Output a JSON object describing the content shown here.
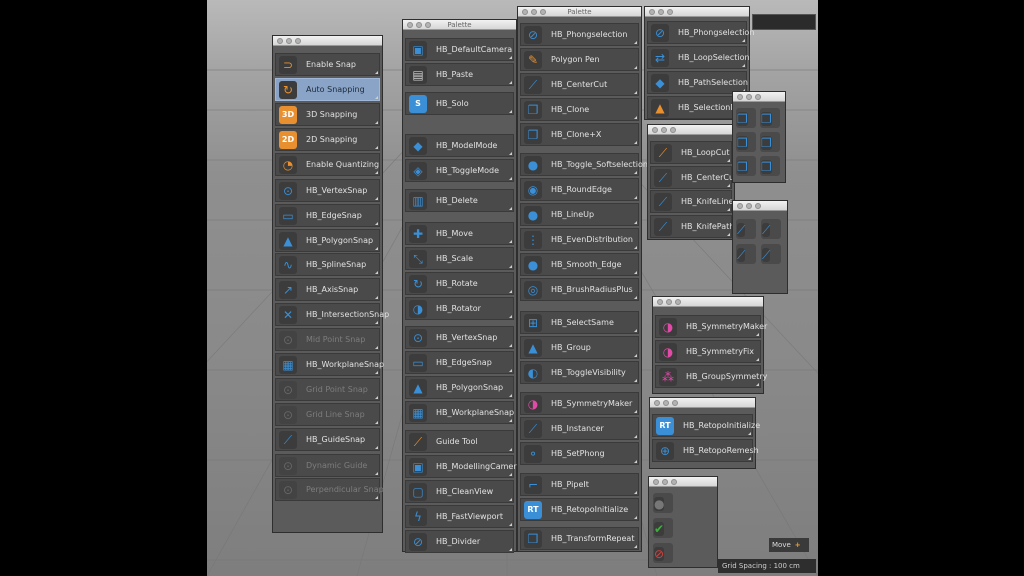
{
  "palettes": {
    "snap": {
      "items": [
        {
          "label": "Enable Snap",
          "icon": "magnet-icon"
        },
        {
          "label": "Auto Snapping",
          "icon": "auto-snap-icon",
          "selected": true
        },
        {
          "label": "3D Snapping",
          "icon": "3d-snap-icon",
          "badge": "3D"
        },
        {
          "label": "2D Snapping",
          "icon": "2d-snap-icon",
          "badge": "2D"
        },
        {
          "label": "Enable Quantizing",
          "icon": "quantize-icon"
        },
        {
          "label": "HB_VertexSnap",
          "icon": "vertex-snap-icon"
        },
        {
          "label": "HB_EdgeSnap",
          "icon": "edge-snap-icon"
        },
        {
          "label": "HB_PolygonSnap",
          "icon": "polygon-snap-icon"
        },
        {
          "label": "HB_SplineSnap",
          "icon": "spline-snap-icon"
        },
        {
          "label": "HB_AxisSnap",
          "icon": "axis-snap-icon"
        },
        {
          "label": "HB_IntersectionSnap",
          "icon": "intersection-snap-icon"
        },
        {
          "label": "Mid Point Snap",
          "icon": "midpoint-snap-icon",
          "disabled": true
        },
        {
          "label": "HB_WorkplaneSnap",
          "icon": "workplane-snap-icon"
        },
        {
          "label": "Grid Point Snap",
          "icon": "grid-point-snap-icon",
          "disabled": true
        },
        {
          "label": "Grid Line Snap",
          "icon": "grid-line-snap-icon",
          "disabled": true
        },
        {
          "label": "HB_GuideSnap",
          "icon": "guide-snap-icon"
        },
        {
          "label": "Dynamic Guide",
          "icon": "dynamic-guide-icon",
          "disabled": true
        },
        {
          "label": "Perpendicular Snap",
          "icon": "perpendicular-snap-icon",
          "disabled": true
        }
      ]
    },
    "palette2": {
      "title": "Palette",
      "items": [
        {
          "label": "HB_DefaultCamera",
          "icon": "camera-icon"
        },
        {
          "label": "HB_Paste",
          "icon": "paste-icon"
        },
        {
          "label": "HB_Solo",
          "icon": "solo-icon",
          "badge": "S"
        },
        {
          "label": "HB_ModelMode",
          "icon": "model-mode-icon"
        },
        {
          "label": "HB_ToggleMode",
          "icon": "toggle-mode-icon"
        },
        {
          "label": "HB_Delete",
          "icon": "trash-icon"
        },
        {
          "label": "HB_Move",
          "icon": "move-icon"
        },
        {
          "label": "HB_Scale",
          "icon": "scale-icon"
        },
        {
          "label": "HB_Rotate",
          "icon": "rotate-icon"
        },
        {
          "label": "HB_Rotator",
          "icon": "rotator-icon"
        },
        {
          "label": "HB_VertexSnap",
          "icon": "vertex-snap-icon"
        },
        {
          "label": "HB_EdgeSnap",
          "icon": "edge-snap-icon"
        },
        {
          "label": "HB_PolygonSnap",
          "icon": "polygon-snap-icon"
        },
        {
          "label": "HB_WorkplaneSnap",
          "icon": "workplane-snap-icon"
        },
        {
          "label": "Guide Tool",
          "icon": "guide-tool-icon"
        },
        {
          "label": "HB_ModellingCamera",
          "icon": "modelling-camera-icon"
        },
        {
          "label": "HB_CleanView",
          "icon": "clean-view-icon"
        },
        {
          "label": "HB_FastViewport",
          "icon": "fast-viewport-icon"
        },
        {
          "label": "HB_Divider",
          "icon": "divider-icon"
        }
      ]
    },
    "palette3": {
      "title": "Palette",
      "items": [
        {
          "label": "HB_Phongselection",
          "icon": "phong-selection-icon"
        },
        {
          "label": "Polygon Pen",
          "icon": "polygon-pen-icon"
        },
        {
          "label": "HB_CenterCut",
          "icon": "center-cut-icon"
        },
        {
          "label": "HB_Clone",
          "icon": "clone-icon"
        },
        {
          "label": "HB_Clone+X",
          "icon": "clone-x-icon"
        },
        {
          "label": "HB_Toggle_Softselection",
          "icon": "soft-selection-icon"
        },
        {
          "label": "HB_RoundEdge",
          "icon": "round-edge-icon"
        },
        {
          "label": "HB_LineUp",
          "icon": "line-up-icon"
        },
        {
          "label": "HB_EvenDistribution",
          "icon": "even-distribution-icon"
        },
        {
          "label": "HB_Smooth_Edge",
          "icon": "smooth-edge-icon"
        },
        {
          "label": "HB_BrushRadiusPlus",
          "icon": "brush-radius-icon"
        },
        {
          "label": "HB_SelectSame",
          "icon": "select-same-icon"
        },
        {
          "label": "HB_Group",
          "icon": "group-icon"
        },
        {
          "label": "HB_ToggleVisibility",
          "icon": "visibility-icon"
        },
        {
          "label": "HB_SymmetryMaker",
          "icon": "symmetry-icon"
        },
        {
          "label": "HB_Instancer",
          "icon": "instancer-icon"
        },
        {
          "label": "HB_SetPhong",
          "icon": "set-phong-icon"
        },
        {
          "label": "HB_PipeIt",
          "icon": "pipe-icon"
        },
        {
          "label": "HB_RetopoInitialize",
          "icon": "retopo-icon",
          "badge": "RT"
        },
        {
          "label": "HB_TransformRepeat",
          "icon": "transform-repeat-icon"
        }
      ]
    },
    "palette4": {
      "items": [
        {
          "label": "HB_Phongselection",
          "icon": "phong-selection-icon"
        },
        {
          "label": "HB_LoopSelection",
          "icon": "loop-selection-icon"
        },
        {
          "label": "HB_PathSelection",
          "icon": "path-selection-icon"
        },
        {
          "label": "HB_SelectionMaker",
          "icon": "selection-maker-icon"
        }
      ]
    },
    "palette5": {
      "items": [
        {
          "label": "HB_LoopCut",
          "icon": "loop-cut-icon"
        },
        {
          "label": "HB_CenterCut",
          "icon": "center-cut-icon"
        },
        {
          "label": "HB_KnifeLine",
          "icon": "knife-line-icon"
        },
        {
          "label": "HB_KnifePath",
          "icon": "knife-path-icon"
        }
      ]
    },
    "palette6": {
      "items": [
        {
          "label": "HB_SymmetryMaker",
          "icon": "symmetry-icon"
        },
        {
          "label": "HB_SymmetryFix",
          "icon": "symmetry-fix-icon"
        },
        {
          "label": "HB_GroupSymmetry",
          "icon": "group-symmetry-icon"
        }
      ]
    },
    "palette7": {
      "items": [
        {
          "label": "HB_RetopoInitialize",
          "icon": "retopo-icon",
          "badge": "RT"
        },
        {
          "label": "HB_RetopoRemesh",
          "icon": "retopo-remesh-icon"
        }
      ]
    },
    "grid_clone": [
      "clone-x-icon",
      "clone-x-icon",
      "clone-y-icon",
      "clone-y-icon",
      "clone-z-icon",
      "clone-z-icon"
    ],
    "grid_knife": [
      "knife-circle-icon",
      "knife-dot-icon",
      "knife-point-icon",
      "knife-spark-icon"
    ],
    "grid_misc": [
      "bomb-icon",
      "check-icon",
      "cancel-icon"
    ]
  },
  "status": {
    "grid_spacing": "Grid Spacing : 100 cm",
    "move_label": "Move"
  },
  "colors": {
    "accent": "#8aa4c8",
    "icon_blue": "#3a8fd6",
    "icon_orange": "#e89030",
    "icon_pink": "#e24aa8"
  }
}
